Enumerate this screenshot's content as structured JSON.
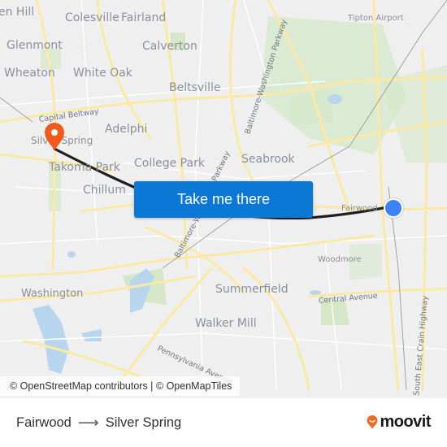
{
  "map": {
    "places": [
      {
        "name": "en Hill",
        "size": "normal"
      },
      {
        "name": "Colesville",
        "size": "normal"
      },
      {
        "name": "Fairland",
        "size": "normal"
      },
      {
        "name": "Glenmont",
        "size": "normal"
      },
      {
        "name": "Calverton",
        "size": "normal"
      },
      {
        "name": "Wheaton",
        "size": "normal"
      },
      {
        "name": "White Oak",
        "size": "normal"
      },
      {
        "name": "Beltsville",
        "size": "normal"
      },
      {
        "name": "Adelphi",
        "size": "normal"
      },
      {
        "name": "Silver Spring",
        "size": "normal"
      },
      {
        "name": "Takoma Park",
        "size": "normal"
      },
      {
        "name": "College Park",
        "size": "normal"
      },
      {
        "name": "Seabrook",
        "size": "normal"
      },
      {
        "name": "Chillum",
        "size": "normal"
      },
      {
        "name": "Washington",
        "size": "normal"
      },
      {
        "name": "Summerfield",
        "size": "normal"
      },
      {
        "name": "Walker Mill",
        "size": "normal"
      },
      {
        "name": "Tipton Airport",
        "size": "small"
      },
      {
        "name": "Fairwood",
        "size": "small"
      },
      {
        "name": "Woodmore",
        "size": "small"
      }
    ],
    "roads": [
      {
        "name": "Capital Beltway"
      },
      {
        "name": "Baltimore-Washington Parkway"
      },
      {
        "name": "Baltimore-Washington Parkway (south)",
        "label": "Baltimore-W..."
      },
      {
        "name": "Parkway segment",
        "label": "Parkway"
      },
      {
        "name": "Central Avenue"
      },
      {
        "name": "Pennsylvania Avenue"
      },
      {
        "name": "South East Crain Highway"
      }
    ],
    "attribution": "© OpenStreetMap contributors | © OpenMapTiles",
    "origin_marker": "origin-dot",
    "destination_marker": "destination-pin",
    "colors": {
      "route": "#1f1f1f",
      "origin": "#3b82f6",
      "destination": "#f25a1c",
      "button": "#0b78d6"
    }
  },
  "cta": {
    "label": "Take me there"
  },
  "footer": {
    "origin": "Fairwood",
    "arrow": "⟶",
    "destination": "Silver Spring",
    "brand": "moovit",
    "brand_color": "#f26a21"
  }
}
